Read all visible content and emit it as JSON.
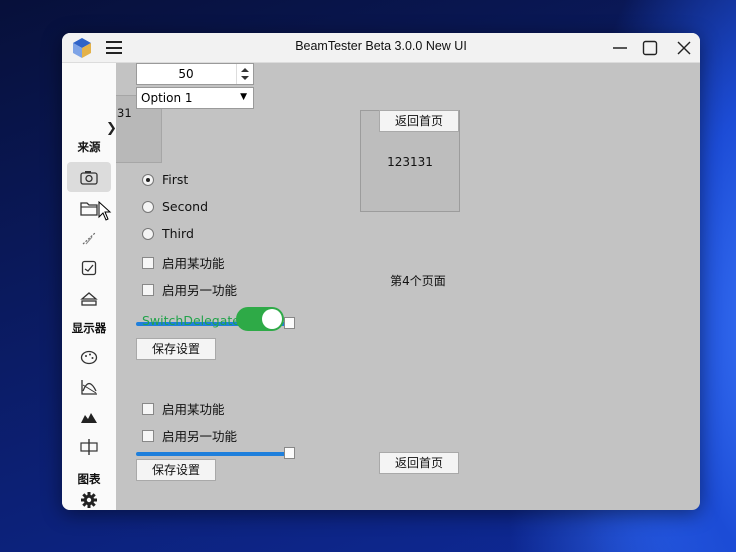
{
  "window": {
    "title": "BeamTester Beta 3.0.0 New UI"
  },
  "sidebar": {
    "sections": {
      "source": "来源",
      "display": "显示器",
      "chart": "图表"
    },
    "icons": [
      "camera-icon",
      "folder-icon",
      "beam-icon",
      "image-icon",
      "eject-icon",
      "palette-icon",
      "chart-icon",
      "mountain-icon",
      "split-icon",
      "gear-icon"
    ]
  },
  "controls": {
    "spin_value": "50",
    "combo_value": "Option 1",
    "partial_card_text": "31",
    "radios": [
      "First",
      "Second",
      "Third"
    ],
    "radio_selected": "First",
    "checkbox_enable_feature": "启用某功能",
    "checkbox_enable_other": "启用另一功能",
    "slider_value": 100,
    "switch_label": "SwitchDelegate",
    "switch_on": true,
    "save_settings": "保存设置"
  },
  "page": {
    "back_home": "返回首页",
    "card_number": "123131",
    "page4_title": "第4个页面"
  },
  "colors": {
    "accent": "#1e7fdc",
    "switch_green": "#2eaa47"
  }
}
